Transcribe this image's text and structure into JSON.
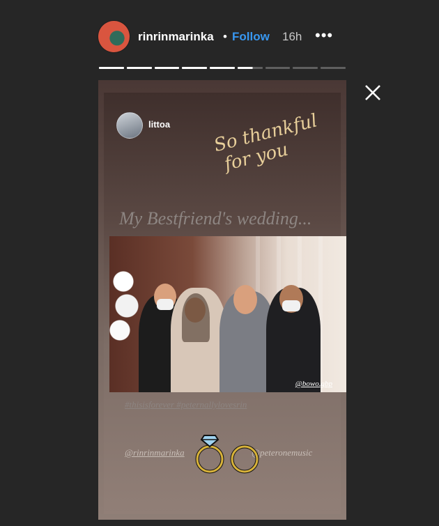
{
  "header": {
    "username": "rinrinmarinka",
    "separator": "•",
    "follow_label": "Follow",
    "time": "16h",
    "more_label": "•••"
  },
  "progress": {
    "total_segments": 9,
    "current_index": 5,
    "current_fill": 0.6
  },
  "story": {
    "reposted_user": "littoa",
    "script_line1": "So thankful",
    "script_line2": "for you",
    "headline": "My Bestfriend's wedding...",
    "photo_credit": "@bowo.gbp",
    "hashtags": "#thisisforever #peternallylovesrin",
    "mention_left": "@rinrinmarinka",
    "mention_right": "@peteronemusic"
  },
  "colors": {
    "background": "#262626",
    "accent": "#3897f0",
    "script_gold": "#e8cf9a"
  },
  "icons": [
    "more-icon",
    "close-icon",
    "wedding-rings-icon"
  ]
}
